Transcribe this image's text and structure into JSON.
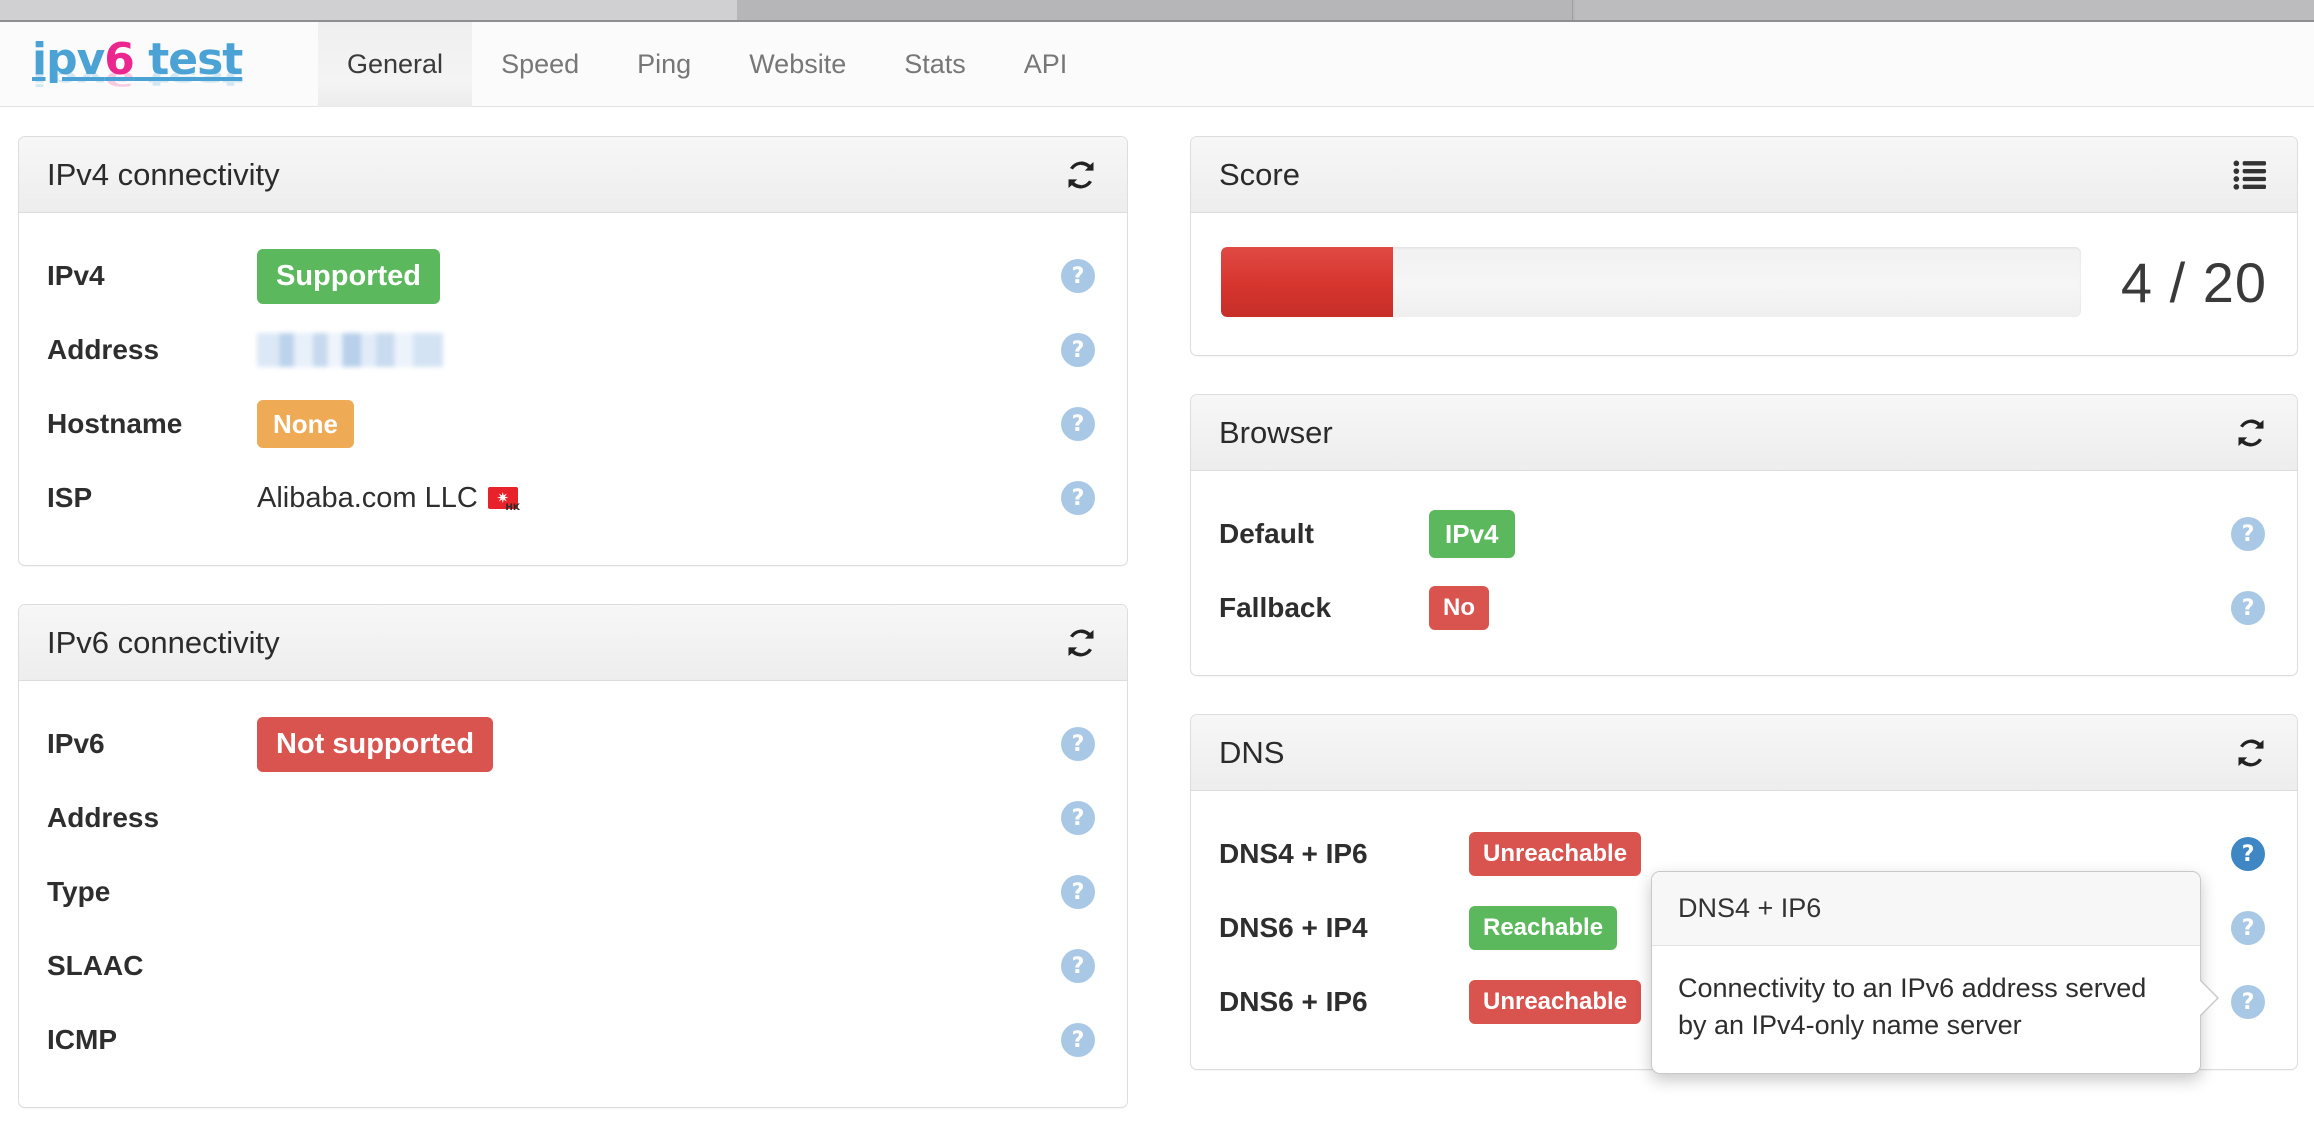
{
  "browser_chrome": {
    "tabs": [
      {
        "name": "active-tab",
        "state": "active"
      },
      {
        "name": "inactive-tab-1",
        "state": "inactive"
      },
      {
        "name": "inactive-tab-2",
        "state": "inactive"
      }
    ]
  },
  "site": {
    "logo_part1": "ipv",
    "logo_six": "6",
    "logo_part2": " test",
    "nav_tabs": [
      {
        "label": "General",
        "active": true
      },
      {
        "label": "Speed",
        "active": false
      },
      {
        "label": "Ping",
        "active": false
      },
      {
        "label": "Website",
        "active": false
      },
      {
        "label": "Stats",
        "active": false
      },
      {
        "label": "API",
        "active": false
      }
    ]
  },
  "ipv4_panel": {
    "title": "IPv4 connectivity",
    "refresh_icon": "refresh-icon",
    "rows": [
      {
        "label": "IPv4",
        "value": "Supported",
        "kind": "badge-green",
        "help": "?"
      },
      {
        "label": "Address",
        "value": "",
        "kind": "redacted",
        "help": "?"
      },
      {
        "label": "Hostname",
        "value": "None",
        "kind": "badge-orange",
        "help": "?"
      },
      {
        "label": "ISP",
        "value": "Alibaba.com LLC",
        "kind": "text-flag",
        "flag": "HK",
        "help": "?"
      }
    ]
  },
  "ipv6_panel": {
    "title": "IPv6 connectivity",
    "refresh_icon": "refresh-icon",
    "rows": [
      {
        "label": "IPv6",
        "value": "Not supported",
        "kind": "badge-red",
        "help": "?"
      },
      {
        "label": "Address",
        "value": "",
        "kind": "empty",
        "help": "?"
      },
      {
        "label": "Type",
        "value": "",
        "kind": "empty",
        "help": "?"
      },
      {
        "label": "SLAAC",
        "value": "",
        "kind": "empty",
        "help": "?"
      },
      {
        "label": "ICMP",
        "value": "",
        "kind": "empty",
        "help": "?"
      }
    ]
  },
  "score_panel": {
    "title": "Score",
    "list_icon": "list-icon",
    "value": 4,
    "max": 20,
    "display": "4 / 20",
    "percent": 20,
    "bar_color": "#d6352e"
  },
  "browser_panel": {
    "title": "Browser",
    "refresh_icon": "refresh-icon",
    "rows": [
      {
        "label": "Default",
        "value": "IPv4",
        "kind": "badge-green",
        "help": "?"
      },
      {
        "label": "Fallback",
        "value": "No",
        "kind": "badge-red",
        "help": "?"
      }
    ]
  },
  "dns_panel": {
    "title": "DNS",
    "refresh_icon": "refresh-icon",
    "rows": [
      {
        "label": "DNS4 + IP6",
        "value": "Unreachable",
        "kind": "badge-red",
        "help": "?",
        "help_active": true
      },
      {
        "label": "DNS6 + IP4",
        "value": "Reachable",
        "kind": "badge-green",
        "help": "?",
        "help_active": false
      },
      {
        "label": "DNS6 + IP6",
        "value": "Unreachable",
        "kind": "badge-red",
        "help": "?",
        "help_active": false
      }
    ]
  },
  "tooltip": {
    "title": "DNS4 + IP6",
    "body": "Connectivity to an IPv6 address served by an IPv4-only name server"
  },
  "colors": {
    "green": "#5cb85c",
    "red": "#d9534f",
    "orange": "#eeaa55",
    "logo_blue": "#4aa3d4",
    "logo_pink": "#ec268f",
    "help_inactive": "#a8c8e5",
    "help_active": "#3f86c4"
  }
}
